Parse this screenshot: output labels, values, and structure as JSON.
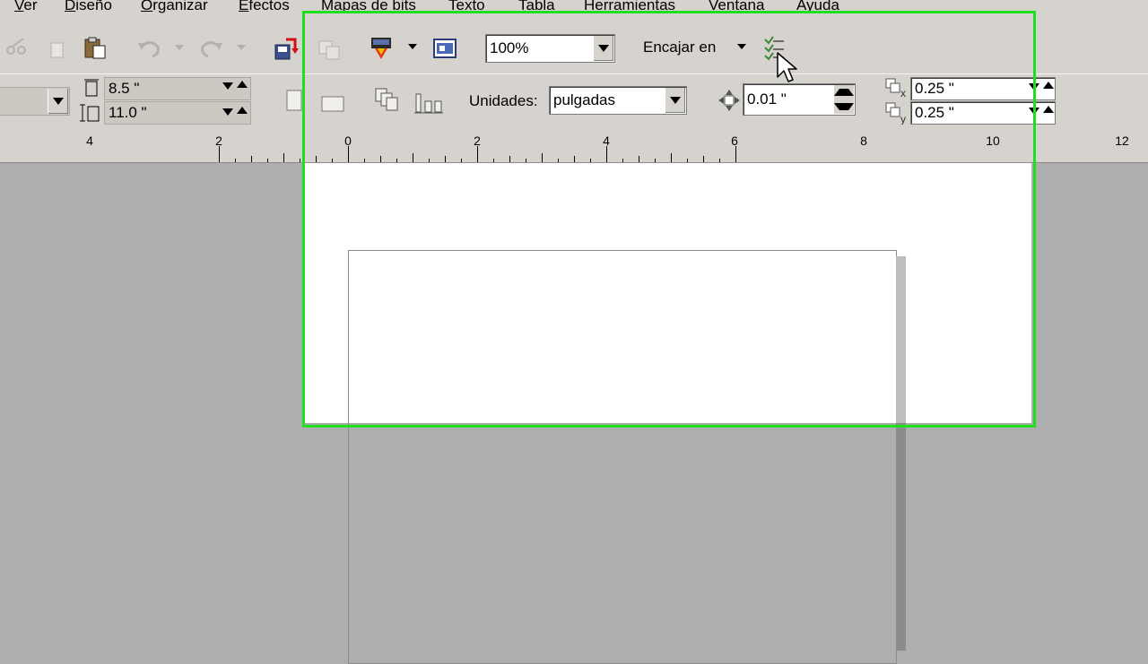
{
  "menu": [
    "Ver",
    "Diseño",
    "Organizar",
    "Efectos",
    "Mapas de bits",
    "Texto",
    "Tabla",
    "Herramientas",
    "Ventana",
    "Ayuda"
  ],
  "toolbar": {
    "zoom_value": "100%",
    "snap_label": "Encajar en"
  },
  "property_bar": {
    "page_width": "8.5 \"",
    "page_height": "11.0 \"",
    "units_label": "Unidades:",
    "units_value": "pulgadas",
    "nudge_value": "0.01 \"",
    "duplicate_x": "0.25 \"",
    "duplicate_y": "0.25 \""
  },
  "ruler": {
    "labels": [
      "4",
      "2",
      "0",
      "2",
      "4",
      "6",
      "8",
      "10",
      "12"
    ]
  },
  "colors": {
    "ui_face": "#d6d3ce",
    "desktop": "#aeaeae",
    "highlight": "#1fe01f"
  }
}
